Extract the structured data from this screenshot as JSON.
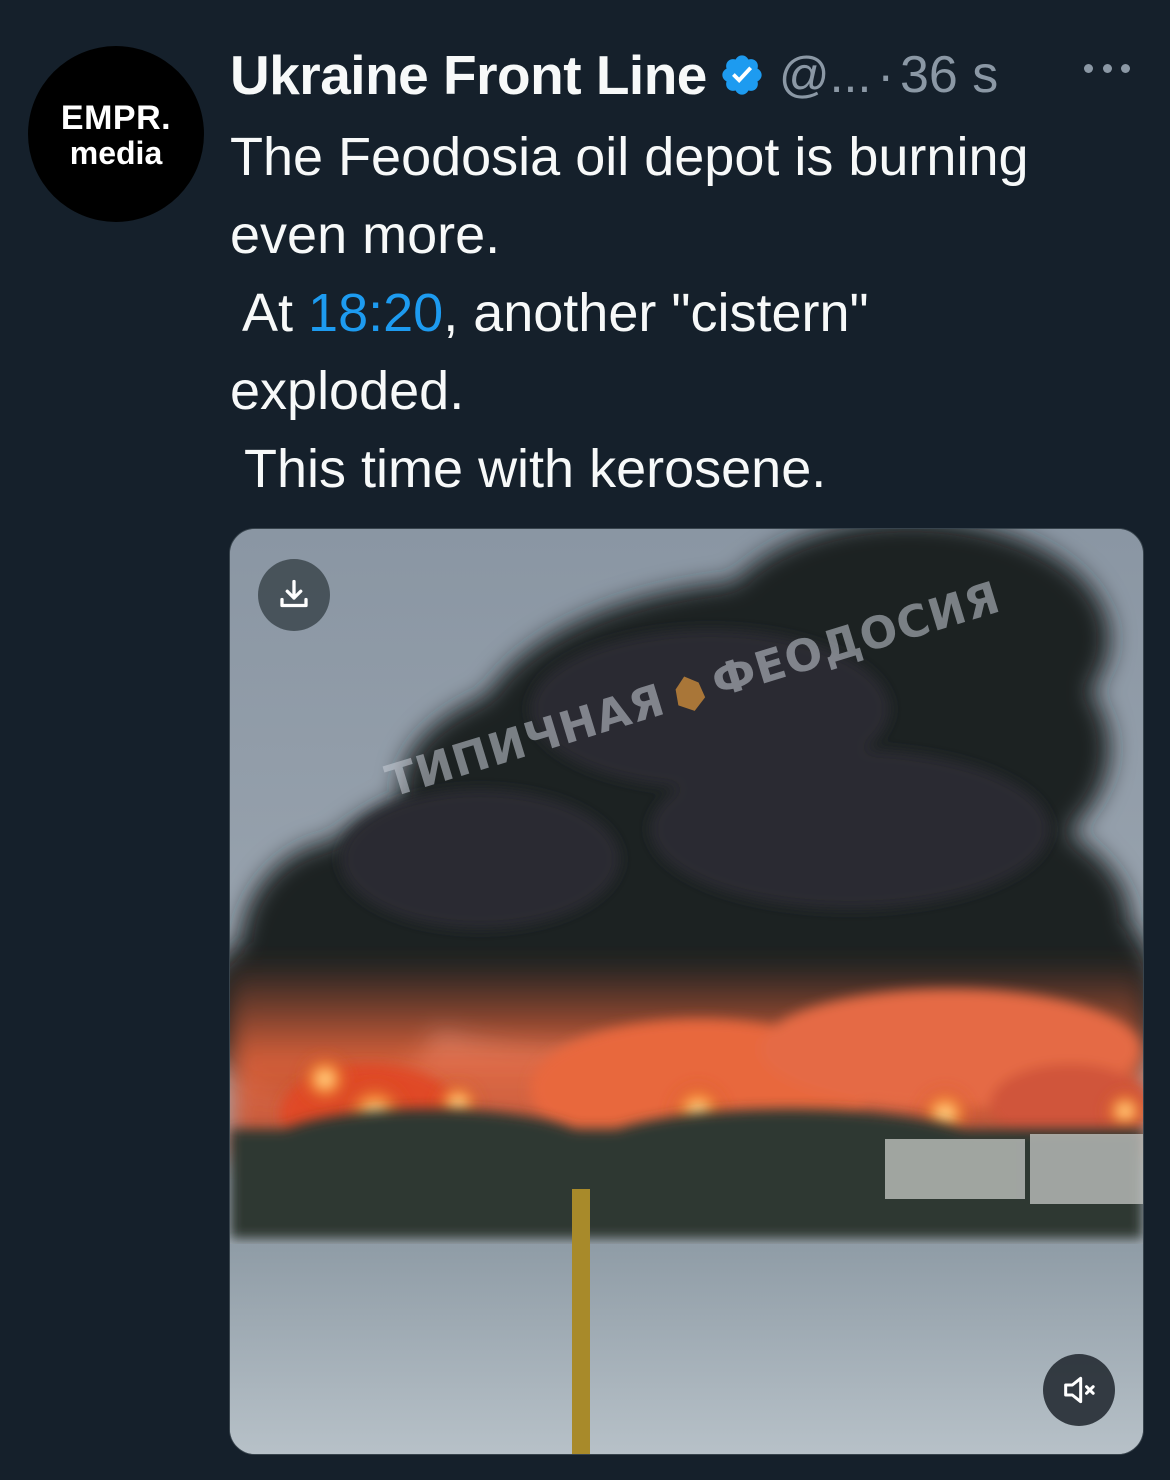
{
  "avatar": {
    "line1": "EMPR.",
    "line2": "media"
  },
  "author": {
    "name": "Ukraine Front Line",
    "handle": "@...",
    "separator": "·",
    "time": "36 s",
    "verified_color": "#1d9bf0"
  },
  "tweet": {
    "line1": "The Feodosia oil depot is burning",
    "line2": "even more.",
    "line3_prefix": " At ",
    "line3_link": "18:20",
    "line3_suffix": ", another \"cistern\"",
    "line4": "exploded.",
    "line5": " This time with kerosene."
  },
  "media": {
    "watermark_left": "ТИПИЧНАЯ",
    "watermark_right": "ФЕОДОСИЯ",
    "download_icon": "download-icon",
    "mute_icon": "speaker-muted-icon"
  },
  "colors": {
    "background": "#15202b",
    "text": "#f7f9f9",
    "muted": "#8b98a5",
    "link": "#1d9bf0"
  }
}
